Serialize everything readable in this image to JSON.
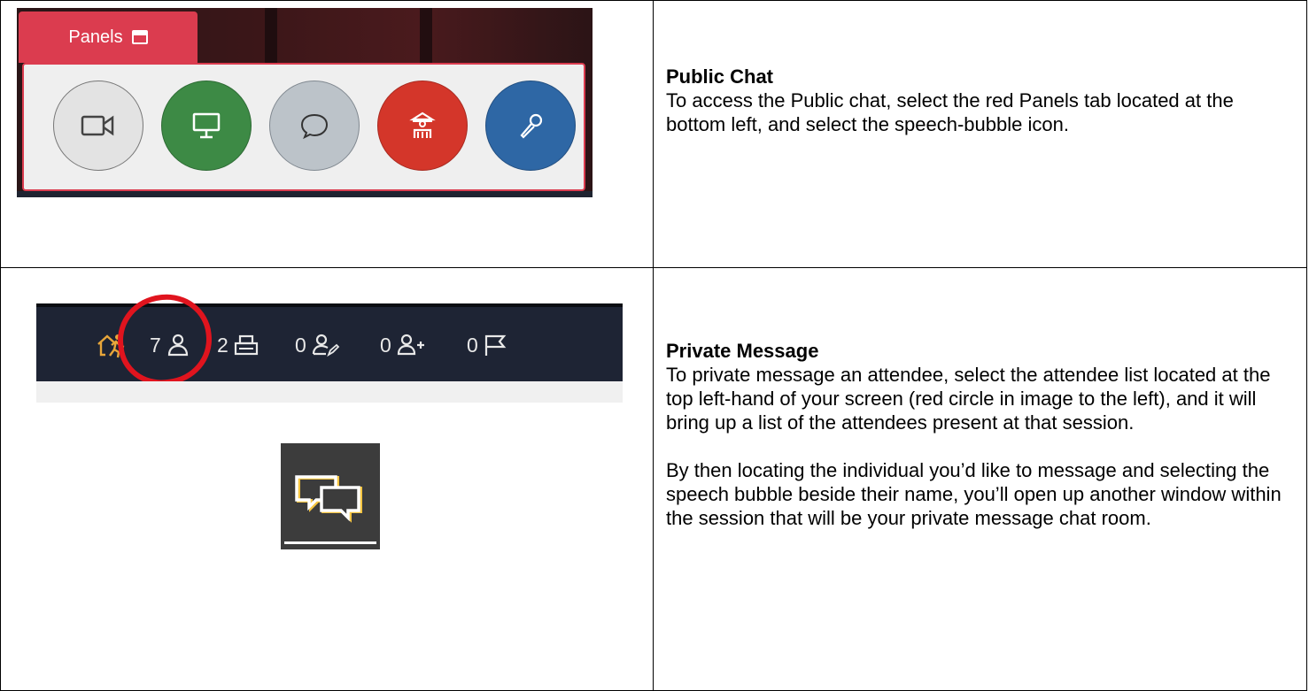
{
  "panels_ui": {
    "tab_label": "Panels",
    "icons": [
      "calendar-icon",
      "video-camera-icon",
      "monitor-icon",
      "speech-bubble-icon",
      "stage-icon",
      "microphone-icon"
    ],
    "colors": {
      "tab": "#db3c4f",
      "video": "#e3e3e3",
      "screen": "#3d8a45",
      "chat": "#bcc3c9",
      "stage": "#d4362a",
      "mic": "#2e67a5"
    }
  },
  "status_bar": {
    "items": [
      {
        "value": "",
        "icon": "exit-person-icon"
      },
      {
        "value": "7",
        "icon": "person-icon"
      },
      {
        "value": "2",
        "icon": "printer-icon"
      },
      {
        "value": "0",
        "icon": "person-pen-icon"
      },
      {
        "value": "0",
        "icon": "person-add-icon"
      },
      {
        "value": "0",
        "icon": "flag-icon"
      }
    ],
    "highlight_color": "#e0141e"
  },
  "chat_icon": {
    "icon": "private-chat-bubbles-icon"
  },
  "sections": [
    {
      "heading": "Public Chat",
      "paragraphs": [
        "To access the Public chat, select the red Panels tab located at the bottom left, and select the speech-bubble icon."
      ]
    },
    {
      "heading": "Private Message",
      "paragraphs": [
        "To private message an attendee, select the attendee list located at the top left-hand of your screen (red circle in image to the left), and it will bring up a list of the attendees present at that session.",
        "By then locating the individual you’d like to message and selecting the speech bubble beside their name, you’ll open up another window within the session that will be your private message chat room."
      ]
    }
  ]
}
